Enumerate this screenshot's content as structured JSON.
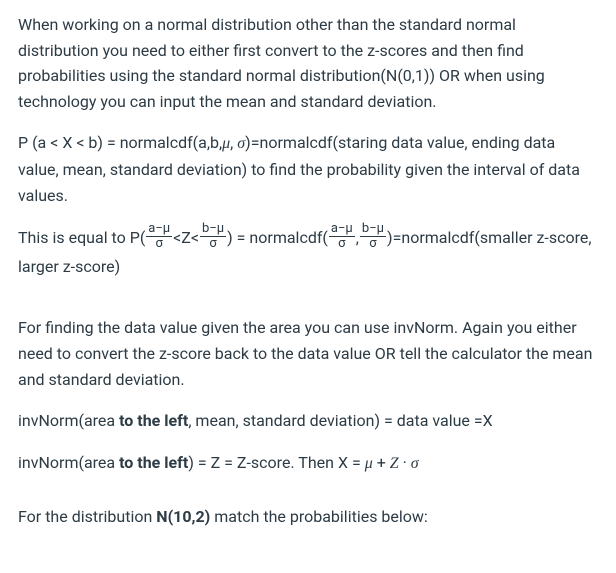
{
  "p1": "When working on a normal distribution other than the standard normal distribution you need to either first convert to the z-scores and then find probabilities using the standard normal distribution(N(0,1)) OR when using technology you can input the mean and standard deviation.",
  "p2_a": "P (a < X < b) = normalcdf(a,b,",
  "p2_mu": "μ",
  "p2_b": ", ",
  "p2_sigma": "σ",
  "p2_c": ")=normalcdf(staring data value, ending data value, mean, standard deviation) to find the probability given the interval of data values.",
  "p3_a": "This is equal to P(",
  "p3_frac1_num": "a−μ",
  "p3_frac1_den": "σ",
  "p3_b": "<Z<",
  "p3_frac2_num": "b−μ",
  "p3_frac2_den": "σ",
  "p3_c": ") = normalcdf(",
  "p3_frac3_num": "a−μ",
  "p3_frac3_den": "σ",
  "p3_d": ",",
  "p3_frac4_num": "b−μ",
  "p3_frac4_den": "σ",
  "p3_e": ")=normalcdf(smaller z-score, larger z-score)",
  "p4": "For finding the data value given the area you can use invNorm. Again you either need to convert the z-score back to the data value OR tell the calculator the mean and standard deviation.",
  "p5_a": "invNorm(area ",
  "p5_bold": "to the left",
  "p5_b": ", mean, standard deviation) = data value =X",
  "p6_a": "invNorm(area ",
  "p6_bold": "to the left",
  "p6_b": ") = Z = Z-score. Then X = ",
  "p6_mu": "μ",
  "p6_plus": " + ",
  "p6_z": "Z",
  "p6_dot": " · ",
  "p6_sigma": "σ",
  "p7_a": "For the distribution ",
  "p7_bold": "N(10,2)",
  "p7_b": " match the probabilities below:"
}
